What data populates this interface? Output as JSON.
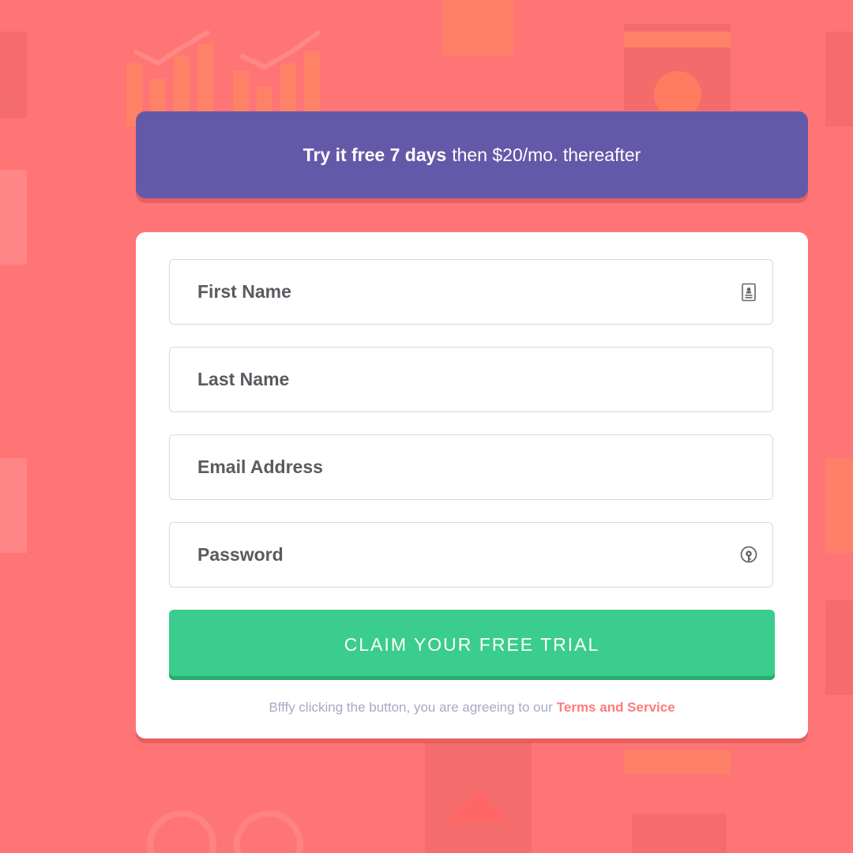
{
  "banner": {
    "strong_text": "Try it free 7 days",
    "rest_text": "then $20/mo. thereafter"
  },
  "form": {
    "first_name": {
      "placeholder": "First Name",
      "icon": "contact-card-icon"
    },
    "last_name": {
      "placeholder": "Last Name"
    },
    "email": {
      "placeholder": "Email Address"
    },
    "password": {
      "placeholder": "Password",
      "icon": "key-password-icon"
    },
    "submit_label": "CLAIM YOUR FREE TRIAL",
    "terms_prefix": "Bfffy clicking the button, you are agreeing to our",
    "terms_link": "Terms and Service"
  },
  "colors": {
    "background": "#ff7575",
    "banner": "#6459a8",
    "button": "#3acd8d",
    "link": "#ff7b7b"
  }
}
